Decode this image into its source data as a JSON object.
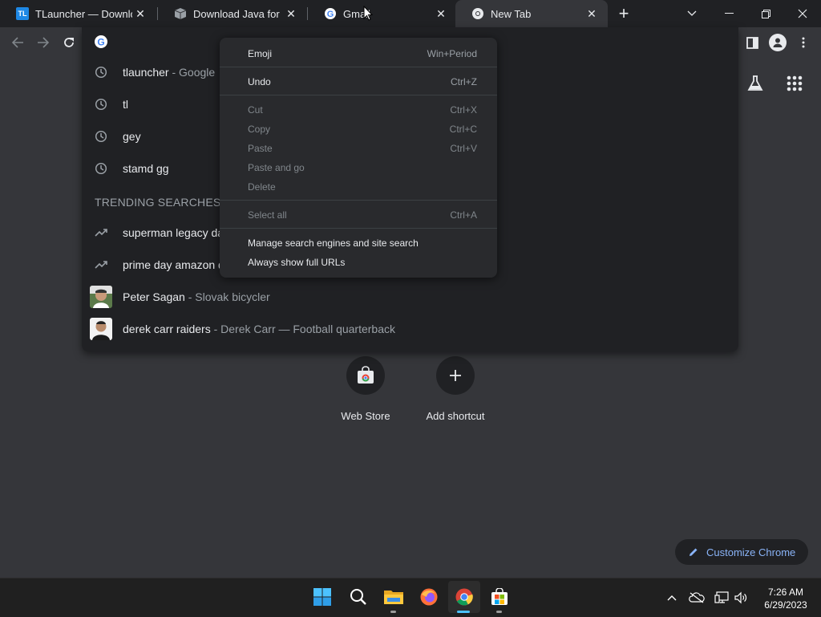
{
  "tabs": [
    {
      "title": "TLauncher — Downloa",
      "favicon": "tlauncher-logo",
      "favicon_text": "TL"
    },
    {
      "title": "Download Java for Mir",
      "favicon": "java-box-icon"
    },
    {
      "title": "Gmail",
      "favicon": "google-g-icon"
    },
    {
      "title": "New Tab",
      "favicon": "chrome-icon",
      "active": true
    }
  ],
  "new_tab_symbol": "+",
  "omnibox": {
    "suggestions": [
      {
        "type": "history",
        "icon": "clock-icon",
        "text": "tlauncher",
        "sub": " - Google"
      },
      {
        "type": "history",
        "icon": "clock-icon",
        "text": "tl",
        "sub": ""
      },
      {
        "type": "history",
        "icon": "clock-icon",
        "text": "gey",
        "sub": ""
      },
      {
        "type": "history",
        "icon": "clock-icon",
        "text": "stamd gg",
        "sub": ""
      }
    ],
    "trending_header": "TRENDING SEARCHES",
    "trending": [
      {
        "icon": "trending-icon",
        "text": "superman legacy da",
        "sub": ""
      },
      {
        "icon": "trending-icon",
        "text": "prime day amazon d",
        "sub": ""
      },
      {
        "icon": "thumbnail",
        "text": "Peter Sagan",
        "sub": " - Slovak bicycler"
      },
      {
        "icon": "thumbnail",
        "text": "derek carr raiders",
        "sub": " - Derek Carr — Football quarterback"
      }
    ]
  },
  "context_menu": {
    "groups": [
      [
        {
          "label": "Emoji",
          "shortcut": "Win+Period",
          "enabled": true
        }
      ],
      [
        {
          "label": "Undo",
          "shortcut": "Ctrl+Z",
          "enabled": true
        }
      ],
      [
        {
          "label": "Cut",
          "shortcut": "Ctrl+X",
          "enabled": false
        },
        {
          "label": "Copy",
          "shortcut": "Ctrl+C",
          "enabled": false
        },
        {
          "label": "Paste",
          "shortcut": "Ctrl+V",
          "enabled": false
        },
        {
          "label": "Paste and go",
          "shortcut": "",
          "enabled": false
        },
        {
          "label": "Delete",
          "shortcut": "",
          "enabled": false
        }
      ],
      [
        {
          "label": "Select all",
          "shortcut": "Ctrl+A",
          "enabled": false
        }
      ],
      [
        {
          "label": "Manage search engines and site search",
          "shortcut": "",
          "enabled": true
        },
        {
          "label": "Always show full URLs",
          "shortcut": "",
          "enabled": true
        }
      ]
    ]
  },
  "shortcuts": [
    {
      "label": "Web Store",
      "icon": "web-store-icon"
    },
    {
      "label": "Add shortcut",
      "icon": "plus-icon"
    }
  ],
  "customize_label": "Customize Chrome",
  "taskbar": {
    "apps": [
      "windows-start-icon",
      "search-icon",
      "file-explorer-icon",
      "firefox-icon",
      "chrome-icon",
      "microsoft-store-icon"
    ],
    "time": "7:26 AM",
    "date": "6/29/2023"
  },
  "colors": {
    "background": "#35363a",
    "tab_strip": "#202124",
    "menu": "#292a2d",
    "accent_link": "#8ab4f8"
  }
}
